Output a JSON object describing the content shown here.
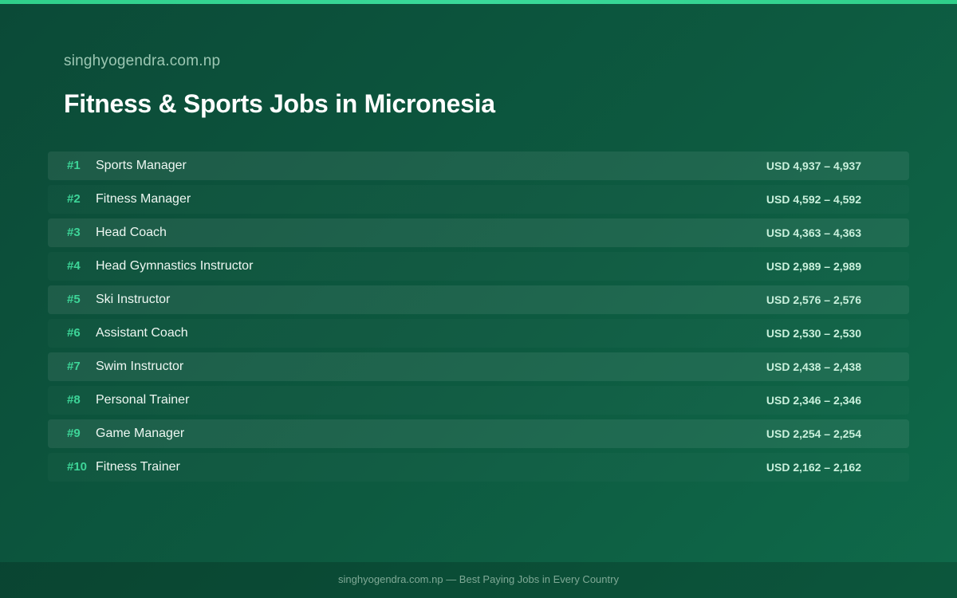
{
  "site": "singhyogendra.com.np",
  "title": "Fitness & Sports Jobs in Micronesia",
  "colors": {
    "accent": "#3dd598",
    "background": "#0d5a40"
  },
  "jobs": [
    {
      "rank": "#1",
      "title": "Sports Manager",
      "salary": "USD 4,937 – 4,937"
    },
    {
      "rank": "#2",
      "title": "Fitness Manager",
      "salary": "USD 4,592 – 4,592"
    },
    {
      "rank": "#3",
      "title": "Head Coach",
      "salary": "USD 4,363 – 4,363"
    },
    {
      "rank": "#4",
      "title": "Head Gymnastics Instructor",
      "salary": "USD 2,989 – 2,989"
    },
    {
      "rank": "#5",
      "title": "Ski Instructor",
      "salary": "USD 2,576 – 2,576"
    },
    {
      "rank": "#6",
      "title": "Assistant Coach",
      "salary": "USD 2,530 – 2,530"
    },
    {
      "rank": "#7",
      "title": "Swim Instructor",
      "salary": "USD 2,438 – 2,438"
    },
    {
      "rank": "#8",
      "title": "Personal Trainer",
      "salary": "USD 2,346 – 2,346"
    },
    {
      "rank": "#9",
      "title": "Game Manager",
      "salary": "USD 2,254 – 2,254"
    },
    {
      "rank": "#10",
      "title": "Fitness Trainer",
      "salary": "USD 2,162 – 2,162"
    }
  ],
  "footer": "singhyogendra.com.np — Best Paying Jobs in Every Country"
}
